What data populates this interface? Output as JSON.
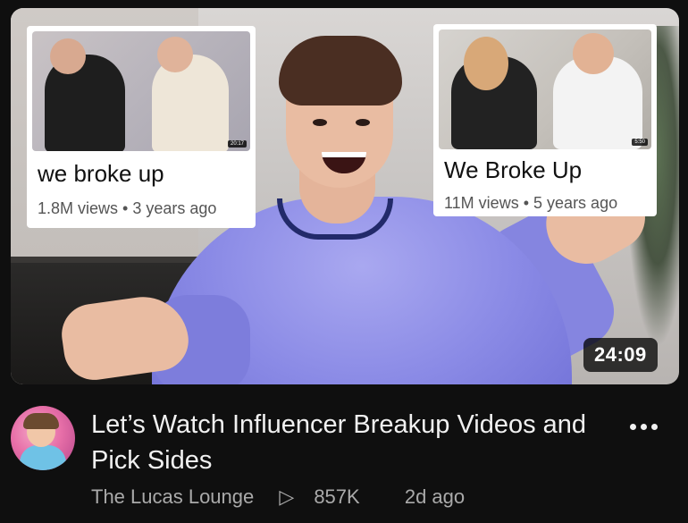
{
  "thumbnail": {
    "duration": "24:09",
    "inset_left": {
      "title": "we broke up",
      "views": "1.8M views",
      "age": "3 years ago",
      "duration": "20:17"
    },
    "inset_right": {
      "title": "We Broke Up",
      "views": "11M views",
      "age_partial": "5 years ago",
      "duration": "5:50"
    }
  },
  "video": {
    "title": "Let’s Watch Influencer Breakup Videos and Pick Sides",
    "channel": "The Lucas Lounge",
    "views": "857K",
    "age": "2d ago",
    "views_icon": "▷"
  },
  "icons": {
    "more": "more-vert-icon",
    "views": "play-outline-icon"
  }
}
